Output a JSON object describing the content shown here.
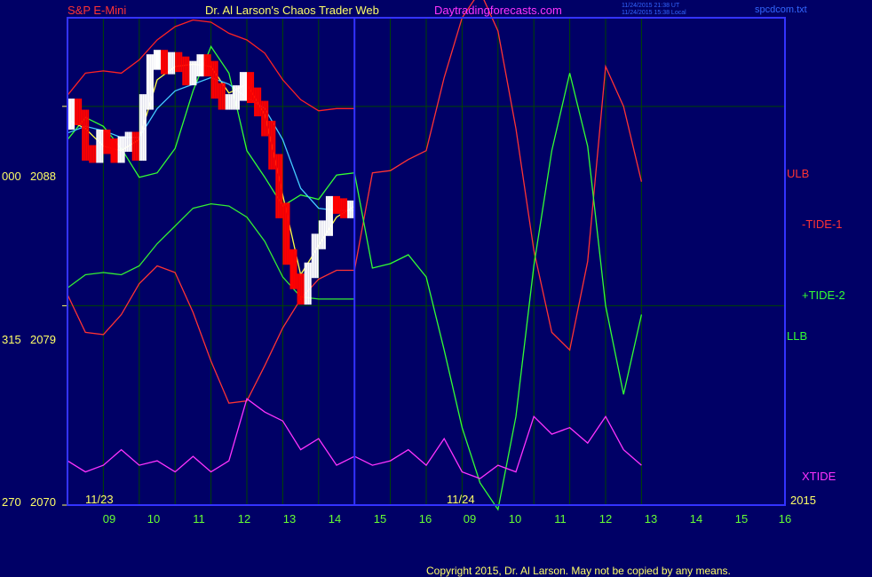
{
  "header": {
    "instrument": "S&P E-Mini",
    "title": "Dr. Al Larson's Chaos Trader Web",
    "site": "Daytradingforecasts.com",
    "timestamp_utc": "11/24/2015 21:38 UT",
    "timestamp_local": "11/24/2015 15:38 Local",
    "file": "spcdcom.txt"
  },
  "footer": {
    "copyright": "Copyright 2015, Dr. Al Larson. May not be copied by any means."
  },
  "colors": {
    "background": "#000066",
    "border": "#3333ff",
    "grid": "#004400",
    "price_up": "#ffffff",
    "price_down": "#ff0000",
    "ulb": "#ff2222",
    "llb": "#33ee33",
    "tide1": "#ff3333",
    "tide2": "#33ff33",
    "xtide": "#ff33ff",
    "avg_fast": "#ffff44",
    "avg_slow": "#44ccff"
  },
  "chart_data": {
    "type": "line",
    "title": "S&P E-Mini",
    "y_axis": {
      "range": [
        2070,
        2092
      ],
      "ticks": [
        {
          "left": "000",
          "value": "2088"
        },
        {
          "left": "315",
          "value": "2079"
        },
        {
          "left": "270",
          "value": "2070"
        }
      ]
    },
    "x_axis": {
      "range": [
        8,
        28
      ],
      "tick_labels": [
        "09",
        "10",
        "11",
        "12",
        "13",
        "14",
        "15",
        "16",
        "09",
        "10",
        "11",
        "12",
        "13",
        "14",
        "15",
        "16"
      ],
      "tick_positions": [
        9,
        10,
        11,
        12,
        13,
        14,
        15,
        16,
        17,
        18,
        19,
        20,
        21,
        22,
        23,
        24
      ],
      "date_labels": [
        {
          "text": "11/23",
          "x": 8.3
        },
        {
          "text": "11/24",
          "x": 16.3
        }
      ],
      "year_label": "2015",
      "session_split": 16
    },
    "series": [
      {
        "name": "ULB",
        "color": "#ff2222",
        "x": [
          8,
          8.5,
          9,
          9.5,
          10,
          10.5,
          11,
          11.5,
          12,
          12.5,
          13,
          13.5,
          14,
          14.5,
          15,
          15.5,
          16
        ],
        "y": [
          2088.5,
          2089.5,
          2089.6,
          2089.5,
          2090.1,
          2091.0,
          2091.6,
          2091.9,
          2091.8,
          2091.3,
          2091.0,
          2090.4,
          2089.2,
          2088.3,
          2087.8,
          2087.9,
          2087.9
        ]
      },
      {
        "name": "LLB",
        "color": "#33ee33",
        "x": [
          8,
          8.5,
          9,
          9.5,
          10,
          10.5,
          11,
          11.5,
          12,
          12.5,
          13,
          13.5,
          14,
          14.5,
          15,
          15.5,
          16
        ],
        "y": [
          2079.8,
          2080.4,
          2080.5,
          2080.4,
          2080.8,
          2081.8,
          2082.6,
          2083.4,
          2083.6,
          2083.5,
          2083.0,
          2081.9,
          2080.3,
          2079.4,
          2079.3,
          2079.3,
          2079.3
        ]
      },
      {
        "name": "-TIDE-1",
        "color": "#ff3333",
        "x": [
          8,
          8.5,
          9,
          9.5,
          10,
          10.5,
          11,
          11.5,
          12,
          12.5,
          13,
          13.5,
          14,
          14.5,
          15,
          15.5,
          16,
          16.5,
          17,
          17.5,
          18,
          18.5,
          19,
          19.5,
          20,
          20.5,
          21,
          21.5,
          22,
          22.5,
          23,
          23.5,
          24
        ],
        "y": [
          2079.5,
          2077.8,
          2077.7,
          2078.6,
          2080.0,
          2080.8,
          2080.5,
          2078.7,
          2076.5,
          2074.6,
          2074.7,
          2076.3,
          2078.0,
          2079.3,
          2080.2,
          2080.6,
          2080.6,
          2085.0,
          2085.1,
          2085.6,
          2086.0,
          2089.3,
          2092.0,
          2093.2,
          2091.4,
          2087.0,
          2081.5,
          2077.8,
          2077.0,
          2081.0,
          2089.8,
          2088.0,
          2084.6
        ]
      },
      {
        "name": "+TIDE-2",
        "color": "#33ff33",
        "x": [
          8,
          8.5,
          9,
          9.5,
          10,
          10.5,
          11,
          11.5,
          12,
          12.5,
          13,
          13.5,
          14,
          14.5,
          15,
          15.5,
          16,
          16.5,
          17,
          17.5,
          18,
          18.5,
          19,
          19.5,
          20,
          20.5,
          21,
          21.5,
          22,
          22.5,
          23,
          23.5,
          24
        ],
        "y": [
          2086.5,
          2087.5,
          2087.1,
          2086.1,
          2084.8,
          2085.0,
          2086.1,
          2088.7,
          2090.7,
          2089.5,
          2086.0,
          2084.8,
          2083.5,
          2084.0,
          2083.8,
          2084.9,
          2085.0,
          2080.7,
          2080.9,
          2081.3,
          2080.3,
          2077.0,
          2073.5,
          2071.0,
          2069.8,
          2074.0,
          2080.8,
          2086.0,
          2089.5,
          2086.2,
          2079.0,
          2075.0,
          2078.6
        ]
      },
      {
        "name": "XTIDE",
        "color": "#ff33ff",
        "x": [
          8,
          8.5,
          9,
          9.5,
          10,
          10.5,
          11,
          11.5,
          12,
          12.5,
          13,
          13.5,
          14,
          14.5,
          15,
          15.5,
          16,
          16.5,
          17,
          17.5,
          18,
          18.5,
          19,
          19.5,
          20,
          20.5,
          21,
          21.5,
          22,
          22.5,
          23,
          23.5,
          24
        ],
        "y": [
          2072.0,
          2071.5,
          2071.8,
          2072.5,
          2071.8,
          2072.0,
          2071.5,
          2072.2,
          2071.5,
          2072.0,
          2074.8,
          2074.2,
          2073.8,
          2072.5,
          2073.0,
          2071.8,
          2072.2,
          2071.8,
          2072.0,
          2072.5,
          2071.8,
          2073.0,
          2071.5,
          2071.2,
          2071.8,
          2071.5,
          2074.0,
          2073.2,
          2073.5,
          2072.8,
          2074.0,
          2072.5,
          2071.8
        ]
      },
      {
        "name": "Price",
        "color": "#ffffff",
        "x": [
          8,
          8.2,
          8.4,
          8.6,
          8.8,
          9,
          9.2,
          9.4,
          9.6,
          9.8,
          10,
          10.2,
          10.4,
          10.6,
          10.8,
          11,
          11.2,
          11.4,
          11.6,
          11.8,
          12,
          12.2,
          12.4,
          12.6,
          12.8,
          13,
          13.2,
          13.4,
          13.6,
          13.8,
          14,
          14.2,
          14.4,
          14.6,
          14.8,
          15,
          15.2,
          15.4,
          15.6,
          15.8,
          16
        ],
        "y": [
          2087.3,
          2088.0,
          2087.5,
          2085.9,
          2085.8,
          2086.6,
          2086.2,
          2085.8,
          2086.3,
          2086.5,
          2085.9,
          2088.2,
          2090.0,
          2090.2,
          2089.8,
          2090.1,
          2089.9,
          2089.3,
          2089.7,
          2090.0,
          2089.7,
          2088.7,
          2088.2,
          2088.2,
          2088.6,
          2089.2,
          2088.5,
          2087.9,
          2087.0,
          2085.5,
          2083.3,
          2081.2,
          2080.1,
          2079.4,
          2080.6,
          2081.9,
          2082.5,
          2083.6,
          2083.5,
          2083.3,
          2083.4
        ]
      },
      {
        "name": "Fast average",
        "color": "#ffff44",
        "x": [
          8,
          8.5,
          9,
          9.5,
          10,
          10.5,
          11,
          11.5,
          12,
          12.5,
          13,
          13.5,
          14,
          14.5,
          15,
          15.5,
          16
        ],
        "y": [
          2087.4,
          2087.0,
          2086.2,
          2086.0,
          2086.5,
          2089.2,
          2089.8,
          2089.9,
          2089.8,
          2088.6,
          2089.0,
          2087.6,
          2084.0,
          2080.4,
          2081.7,
          2083.0,
          2083.5
        ]
      },
      {
        "name": "Slow average",
        "color": "#44ccff",
        "x": [
          8,
          8.5,
          9,
          9.5,
          10,
          10.5,
          11,
          11.5,
          12,
          12.5,
          13,
          13.5,
          14,
          14.5,
          15,
          15.5,
          16
        ],
        "y": [
          2086.8,
          2087.1,
          2086.9,
          2086.6,
          2086.6,
          2087.9,
          2088.7,
          2089.0,
          2089.3,
          2089.0,
          2088.4,
          2087.9,
          2086.5,
          2084.3,
          2083.4,
          2083.3,
          2083.3
        ]
      }
    ],
    "right_labels": [
      {
        "text": "ULB",
        "color": "#ff3333"
      },
      {
        "text": "-TIDE-1",
        "color": "#ff3333"
      },
      {
        "text": "+TIDE-2",
        "color": "#33ff33"
      },
      {
        "text": "LLB",
        "color": "#33ff33"
      },
      {
        "text": "XTIDE",
        "color": "#ff33ff"
      }
    ]
  }
}
